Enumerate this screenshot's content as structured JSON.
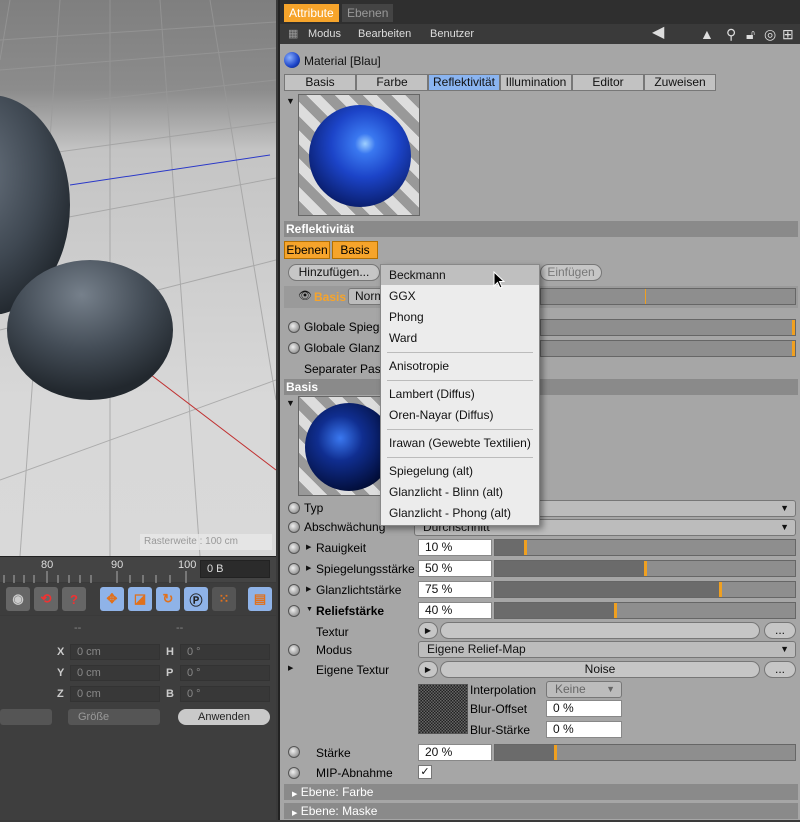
{
  "viewport": {
    "status": "Rasterweite : 100 cm"
  },
  "timeline": {
    "ticks": [
      "80",
      "90",
      "100"
    ],
    "frame": "0 B"
  },
  "coords": {
    "col_headers": [
      "--",
      "--"
    ],
    "rows": [
      {
        "a": "X",
        "av": "0 cm",
        "b": "H",
        "bv": "0 °"
      },
      {
        "a": "Y",
        "av": "0 cm",
        "b": "P",
        "bv": "0 °"
      },
      {
        "a": "Z",
        "av": "0 cm",
        "b": "B",
        "bv": "0 °"
      }
    ],
    "size_dropdown": "Größe",
    "apply_button": "Anwenden"
  },
  "panel": {
    "tabs": [
      "Attribute",
      "Ebenen"
    ],
    "menu": [
      "Modus",
      "Bearbeiten",
      "Benutzer"
    ],
    "material_name": "Material [Blau]",
    "mat_tabs": [
      "Basis",
      "Farbe",
      "Reflektivität",
      "Illumination",
      "Editor",
      "Zuweisen"
    ],
    "section_reflect": "Reflektivität",
    "layer_tabs": [
      "Ebenen",
      "Basis"
    ],
    "add_button": "Hinzufügen...",
    "paste_button": "Einfügen",
    "layer_row": {
      "name": "Basis",
      "mode": "Norm"
    },
    "global_rows": [
      "Globale Spiege",
      "Globale Glanzl",
      "Separater Pass"
    ],
    "section_basis": "Basis",
    "typ_label": "Typ",
    "abschwaechung_label": "Abschwächung",
    "abschwaechung_value": "Durchschnitt",
    "sliders": [
      {
        "label": "Rauigkeit",
        "value": "10 %",
        "level": 0.1
      },
      {
        "label": "Spiegelungsstärke",
        "value": "50 %",
        "level": 0.5
      },
      {
        "label": "Glanzlichtstärke",
        "value": "75 %",
        "level": 0.75
      },
      {
        "label": "Reliefstärke",
        "value": "40 %",
        "level": 0.4
      }
    ],
    "textur_label": "Textur",
    "modus_label": "Modus",
    "modus_value": "Eigene Relief-Map",
    "eigene_textur_label": "Eigene Textur",
    "noise_label": "Noise",
    "dots": "...",
    "interpolation_label": "Interpolation",
    "interpolation_value": "Keine",
    "blur_offset_label": "Blur-Offset",
    "blur_offset_value": "0 %",
    "blur_strength_label": "Blur-Stärke",
    "blur_strength_value": "0 %",
    "staerke_label": "Stärke",
    "staerke_value": "20 %",
    "staerke_level": 0.2,
    "mip_label": "MIP-Abnahme",
    "mip_check": "✓",
    "ebene_farbe": "Ebene: Farbe",
    "ebene_maske": "Ebene: Maske"
  },
  "popup": {
    "items": [
      "Beckmann",
      "GGX",
      "Phong",
      "Ward",
      "Anisotropie",
      "Lambert (Diffus)",
      "Oren-Nayar (Diffus)",
      "Irawan (Gewebte Textilien)",
      "Spiegelung (alt)",
      "Glanzlicht - Blinn (alt)",
      "Glanzlicht - Phong (alt)"
    ]
  },
  "colors": {
    "accent": "#f6a42b",
    "selected_tab": "#8ab4f0",
    "sphere": "#1c44c8"
  }
}
